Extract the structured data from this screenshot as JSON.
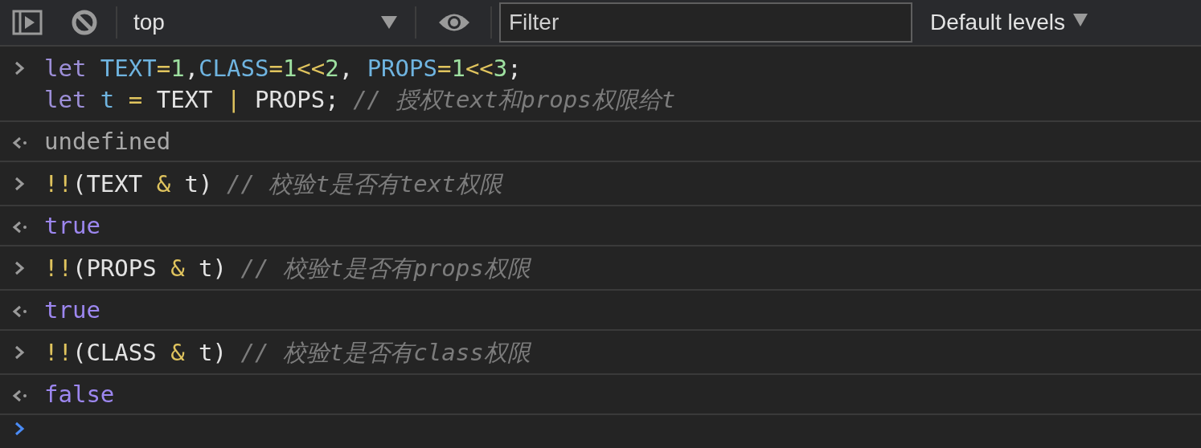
{
  "toolbar": {
    "context": "top",
    "filter": {
      "placeholder": "Filter"
    },
    "levels": "Default levels"
  },
  "entries": [
    {
      "input": [
        [
          {
            "kind": "keyword",
            "text": "let "
          },
          {
            "kind": "variable",
            "text": "TEXT"
          },
          {
            "kind": "operator",
            "text": "="
          },
          {
            "kind": "number",
            "text": "1"
          },
          {
            "kind": "plain",
            "text": ","
          },
          {
            "kind": "variable",
            "text": "CLASS"
          },
          {
            "kind": "operator",
            "text": "="
          },
          {
            "kind": "number",
            "text": "1"
          },
          {
            "kind": "operator",
            "text": "<<"
          },
          {
            "kind": "number",
            "text": "2"
          },
          {
            "kind": "plain",
            "text": ", "
          },
          {
            "kind": "variable",
            "text": "PROPS"
          },
          {
            "kind": "operator",
            "text": "="
          },
          {
            "kind": "number",
            "text": "1"
          },
          {
            "kind": "operator",
            "text": "<<"
          },
          {
            "kind": "number",
            "text": "3"
          },
          {
            "kind": "plain",
            "text": ";"
          }
        ],
        [
          {
            "kind": "keyword",
            "text": "let "
          },
          {
            "kind": "variable",
            "text": "t"
          },
          {
            "kind": "operator",
            "text": " ="
          },
          {
            "kind": "plain",
            "text": " TEXT "
          },
          {
            "kind": "operator",
            "text": "|"
          },
          {
            "kind": "plain",
            "text": " PROPS; "
          },
          {
            "kind": "comment",
            "text": "// 授权text和props权限给t"
          }
        ]
      ],
      "result": {
        "kind": "undefined",
        "text": "undefined"
      }
    },
    {
      "input": [
        [
          {
            "kind": "operator",
            "text": "!!"
          },
          {
            "kind": "plain",
            "text": "(TEXT "
          },
          {
            "kind": "operator",
            "text": "&"
          },
          {
            "kind": "plain",
            "text": " t) "
          },
          {
            "kind": "comment",
            "text": "// 校验t是否有text权限"
          }
        ]
      ],
      "result": {
        "kind": "boolean",
        "text": "true"
      }
    },
    {
      "input": [
        [
          {
            "kind": "operator",
            "text": "!!"
          },
          {
            "kind": "plain",
            "text": "(PROPS "
          },
          {
            "kind": "operator",
            "text": "&"
          },
          {
            "kind": "plain",
            "text": " t) "
          },
          {
            "kind": "comment",
            "text": "// 校验t是否有props权限"
          }
        ]
      ],
      "result": {
        "kind": "boolean",
        "text": "true"
      }
    },
    {
      "input": [
        [
          {
            "kind": "operator",
            "text": "!!"
          },
          {
            "kind": "plain",
            "text": "(CLASS "
          },
          {
            "kind": "operator",
            "text": "&"
          },
          {
            "kind": "plain",
            "text": " t) "
          },
          {
            "kind": "comment",
            "text": "// 校验t是否有class权限"
          }
        ]
      ],
      "result": {
        "kind": "boolean",
        "text": "false"
      }
    }
  ]
}
